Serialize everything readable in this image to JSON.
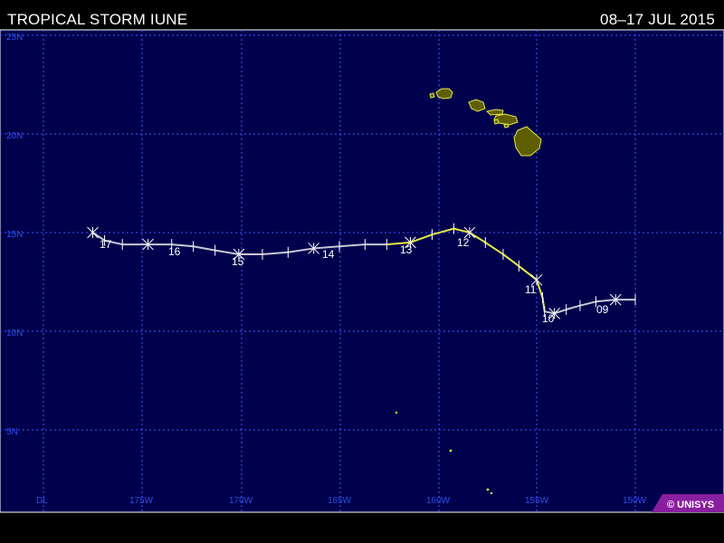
{
  "header": {
    "title": "TROPICAL STORM IUNE",
    "dates": "08–17 JUL 2015"
  },
  "axes": {
    "lat_labels": [
      "25N",
      "20N",
      "15N",
      "10N",
      "5N"
    ],
    "lon_labels": [
      "DL",
      "175W",
      "170W",
      "165W",
      "160W",
      "155W",
      "150W"
    ]
  },
  "track": {
    "day_labels": [
      "17",
      "16",
      "15",
      "14",
      "13",
      "12",
      "11",
      "10",
      "09"
    ],
    "points": [
      {
        "lon": -150.0,
        "lat": 11.6,
        "status": "depression"
      },
      {
        "lon": -151.0,
        "lat": 11.6,
        "status": "depression"
      },
      {
        "lon": -152.0,
        "lat": 11.5,
        "status": "depression"
      },
      {
        "lon": -152.8,
        "lat": 11.3,
        "status": "depression"
      },
      {
        "lon": -153.5,
        "lat": 11.1,
        "status": "depression"
      },
      {
        "lon": -154.1,
        "lat": 10.9,
        "status": "depression"
      },
      {
        "lon": -154.6,
        "lat": 11.0,
        "status": "storm"
      },
      {
        "lon": -154.7,
        "lat": 11.7,
        "status": "storm"
      },
      {
        "lon": -155.0,
        "lat": 12.6,
        "status": "storm"
      },
      {
        "lon": -155.9,
        "lat": 13.3,
        "status": "storm"
      },
      {
        "lon": -156.7,
        "lat": 13.9,
        "status": "storm"
      },
      {
        "lon": -157.6,
        "lat": 14.5,
        "status": "storm"
      },
      {
        "lon": -158.4,
        "lat": 15.0,
        "status": "storm"
      },
      {
        "lon": -159.2,
        "lat": 15.2,
        "status": "storm"
      },
      {
        "lon": -160.3,
        "lat": 14.9,
        "status": "storm"
      },
      {
        "lon": -161.4,
        "lat": 14.5,
        "status": "storm"
      },
      {
        "lon": -162.6,
        "lat": 14.4,
        "status": "storm"
      },
      {
        "lon": -163.7,
        "lat": 14.4,
        "status": "depression"
      },
      {
        "lon": -165.0,
        "lat": 14.3,
        "status": "depression"
      },
      {
        "lon": -166.3,
        "lat": 14.2,
        "status": "depression"
      },
      {
        "lon": -167.6,
        "lat": 14.0,
        "status": "depression"
      },
      {
        "lon": -168.9,
        "lat": 13.9,
        "status": "depression"
      },
      {
        "lon": -170.1,
        "lat": 13.9,
        "status": "depression"
      },
      {
        "lon": -171.3,
        "lat": 14.1,
        "status": "depression"
      },
      {
        "lon": -172.4,
        "lat": 14.3,
        "status": "depression"
      },
      {
        "lon": -173.5,
        "lat": 14.4,
        "status": "depression"
      },
      {
        "lon": -174.7,
        "lat": 14.4,
        "status": "depression"
      },
      {
        "lon": -176.0,
        "lat": 14.4,
        "status": "depression"
      },
      {
        "lon": -176.9,
        "lat": 14.6,
        "status": "depression"
      },
      {
        "lon": -177.5,
        "lat": 15.0,
        "status": "depression"
      }
    ]
  },
  "footer": {
    "copyright": "© UNISYS"
  },
  "colors": {
    "background": "#000000",
    "map_fill": "#00004c",
    "grid": "#3b5bff",
    "label": "#2f4fe6",
    "track_depression": "#c8c8d8",
    "track_storm": "#e8e845",
    "land": "#5e5e00",
    "copyright_badge": "#8a1ea0"
  }
}
